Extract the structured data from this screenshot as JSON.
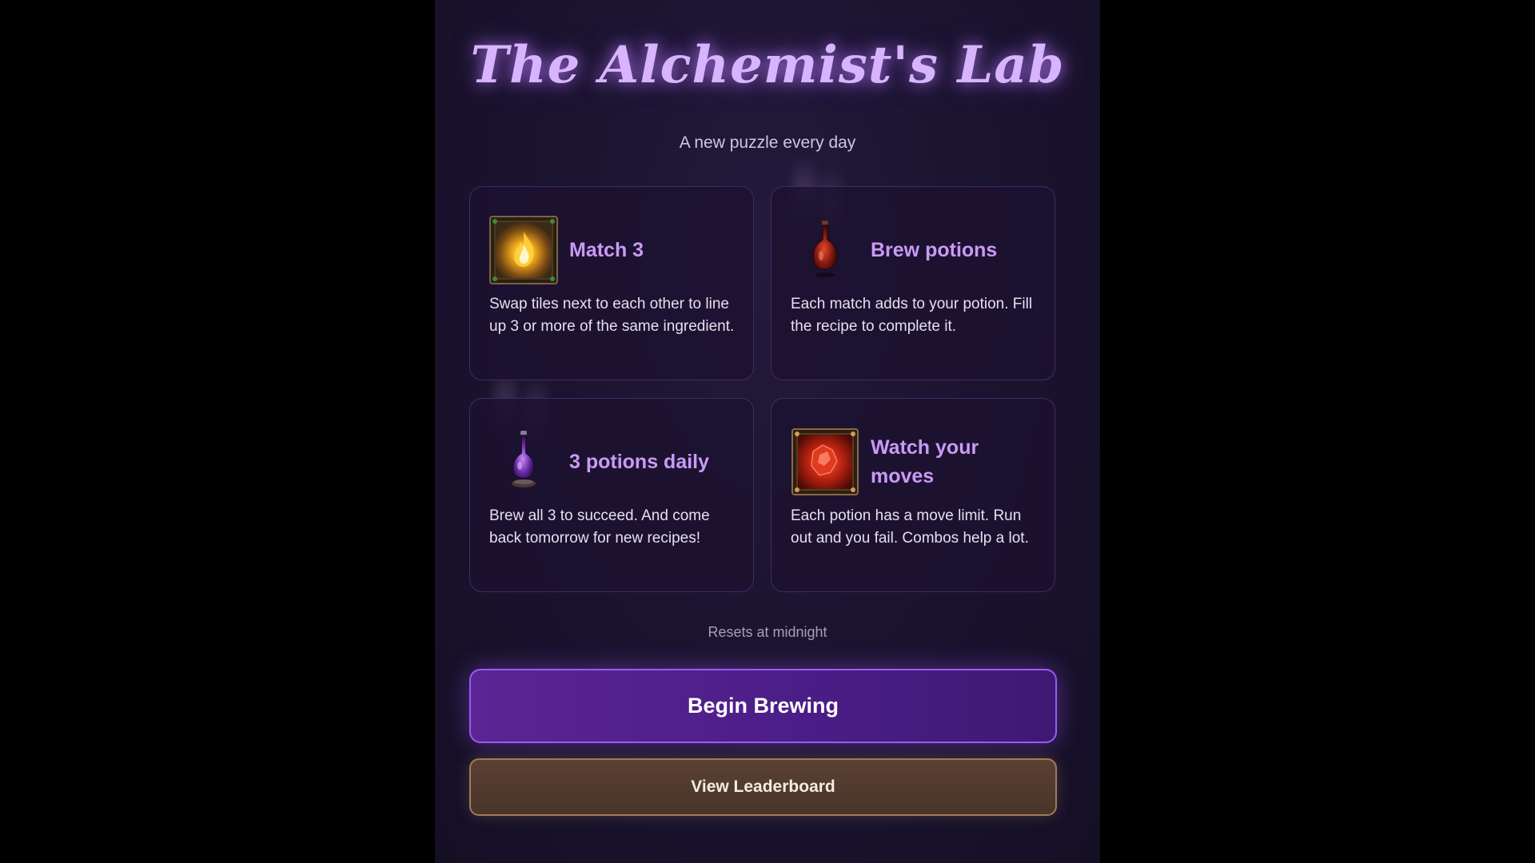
{
  "title": "The Alchemist's Lab",
  "subtitle": "A new puzzle every day",
  "cards": [
    {
      "icon": "fire-ingredient-tile-icon",
      "title": "Match 3",
      "text": "Swap tiles next to each other to line up 3 or more of the same ingredient."
    },
    {
      "icon": "red-potion-flask-icon",
      "title": "Brew potions",
      "text": "Each match adds to your potion. Fill the recipe to complete it."
    },
    {
      "icon": "purple-potion-flask-icon",
      "title": "3 potions daily",
      "text": "Brew all 3 to succeed. And come back tomorrow for new recipes!"
    },
    {
      "icon": "red-crystal-tile-icon",
      "title": "Watch your moves",
      "text": "Each potion has a move limit. Run out and you fail. Combos help a lot."
    }
  ],
  "resets_text": "Resets at midnight",
  "buttons": {
    "primary_label": "Begin Brewing",
    "secondary_label": "View Leaderboard"
  },
  "colors": {
    "accent_purple": "#d8b4fe",
    "card_title": "#c99af5",
    "primary_button": "#5b2594",
    "secondary_button": "#5a4033"
  }
}
